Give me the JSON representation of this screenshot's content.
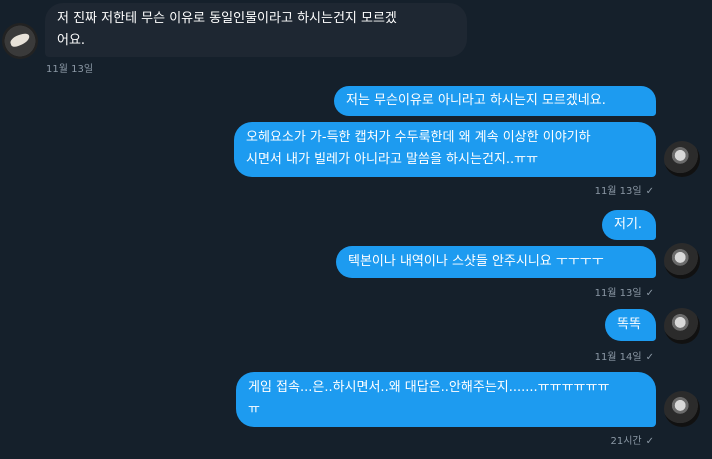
{
  "messages": [
    {
      "text": "저 진짜 저한테 무슨 이유로 동일인물이라고 하시는건지 모르겠\n어요."
    },
    {
      "meta": "11월 13일"
    },
    {
      "text": "저는 무슨이유로 아니라고 하시는지 모르겠네요."
    },
    {
      "text": "오헤요소가 가-득한 캡처가 수두룩한데 왜 계속 이상한 이야기하\n시면서 내가 빌레가 아니라고 말씀을 하시는건지..ㅠㅠ"
    },
    {
      "meta": "11월 13일",
      "check": "✓"
    },
    {
      "text": "저기."
    },
    {
      "text": "텍본이나 내역이나 스샷들 안주시니요 ㅜㅜㅜㅜ"
    },
    {
      "meta": "11월 13일",
      "check": "✓"
    },
    {
      "text": "똑똑"
    },
    {
      "meta": "11월 14일",
      "check": "✓"
    },
    {
      "text": "게임 접속...은..하시면서..왜 대답은..안해주는지.......ㅠㅠㅠㅠㅠㅠ\nㅠ"
    },
    {
      "meta": "21시간",
      "check": "✓"
    }
  ]
}
